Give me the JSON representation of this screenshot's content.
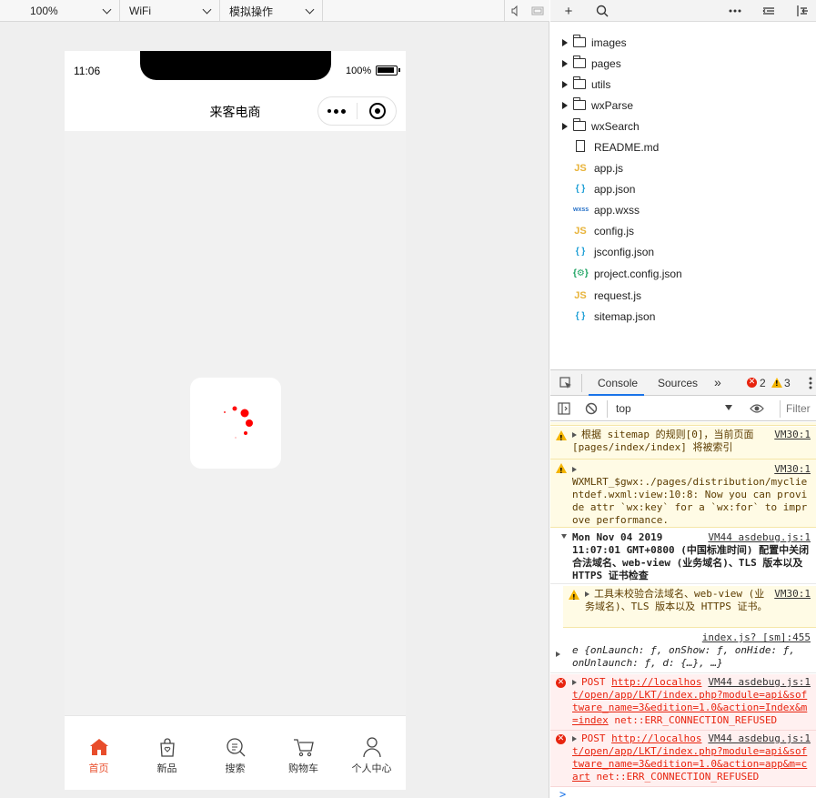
{
  "toolbar": {
    "zoom": "100%",
    "network": "WiFi",
    "operation": "模拟操作"
  },
  "phone": {
    "time": "11:06",
    "battery": "100%",
    "title": "来客电商"
  },
  "tabbar": {
    "items": [
      {
        "label": "首页",
        "icon": "home-icon",
        "active": true
      },
      {
        "label": "新品",
        "icon": "bag-icon",
        "active": false
      },
      {
        "label": "搜索",
        "icon": "search-icon",
        "active": false
      },
      {
        "label": "购物车",
        "icon": "cart-icon",
        "active": false
      },
      {
        "label": "个人中心",
        "icon": "person-icon",
        "active": false
      }
    ],
    "active_color": "#e84d2b"
  },
  "file_tree": {
    "folders": [
      "images",
      "pages",
      "utils",
      "wxParse",
      "wxSearch"
    ],
    "files": [
      {
        "name": "README.md",
        "type": "md"
      },
      {
        "name": "app.js",
        "type": "js"
      },
      {
        "name": "app.json",
        "type": "json"
      },
      {
        "name": "app.wxss",
        "type": "wxss"
      },
      {
        "name": "config.js",
        "type": "js"
      },
      {
        "name": "jsconfig.json",
        "type": "json"
      },
      {
        "name": "project.config.json",
        "type": "config"
      },
      {
        "name": "request.js",
        "type": "js"
      },
      {
        "name": "sitemap.json",
        "type": "json"
      }
    ]
  },
  "devtools": {
    "tabs": [
      "Console",
      "Sources"
    ],
    "more": "»",
    "error_count": "2",
    "warning_count": "3",
    "context": "top",
    "filter_placeholder": "Filter",
    "prompt": ">",
    "messages": [
      {
        "level": "warn",
        "source": "VM30:1",
        "text": "根据 sitemap 的规则[0]，当前页面 [pages/index/index] 将被索引"
      },
      {
        "level": "warn",
        "source": "VM30:1",
        "text": "WXMLRT_$gwx:./pages/distribution/myclientdef.wxml:view:10:8: Now you can provide attr `wx:key` for a `wx:for` to improve performance."
      },
      {
        "level": "group",
        "source": "VM44 asdebug.js:1",
        "text": "Mon Nov 04 2019 11:07:01 GMT+0800 (中国标准时间) 配置中关闭合法域名、web-view (业务域名)、TLS 版本以及 HTTPS 证书检查"
      },
      {
        "level": "warn",
        "source": "VM30:1",
        "text": "工具未校验合法域名、web-view (业务域名)、TLS 版本以及 HTTPS 证书。"
      },
      {
        "level": "info",
        "source": "index.js? [sm]:455",
        "text": "e {onLaunch: ƒ, onShow: ƒ, onHide: ƒ, onUnlaunch: ƒ, d: {…}, …}"
      },
      {
        "level": "error",
        "source": "VM44 asdebug.js:1",
        "method": "POST",
        "url": "http://localhost/open/app/LKT/index.php?module=api&software_name=3&edition=1.0&action=Index&m=index",
        "error": "net::ERR_CONNECTION_REFUSED"
      },
      {
        "level": "error",
        "source": "VM44 asdebug.js:1",
        "method": "POST",
        "url": "http://localhost/open/app/LKT/index.php?module=api&software_name=3&edition=1.0&action=app&m=cart",
        "error": "net::ERR_CONNECTION_REFUSED"
      }
    ]
  }
}
